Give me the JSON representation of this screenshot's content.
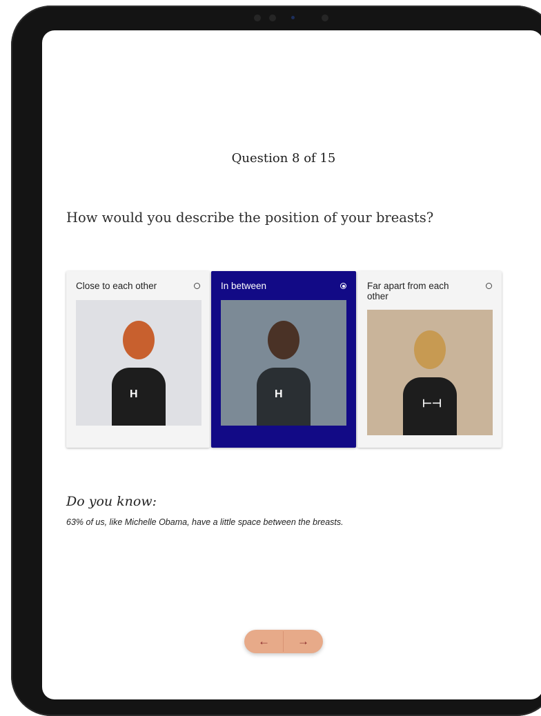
{
  "quiz": {
    "progress": "Question 8 of 15",
    "question": "How would you describe the position of your breasts?",
    "options": [
      {
        "label": "Close to each other",
        "selected": false,
        "marker": "H"
      },
      {
        "label": "In between",
        "selected": true,
        "marker": "H"
      },
      {
        "label": "Far apart from each other",
        "selected": false,
        "marker": "⊢⊣"
      }
    ]
  },
  "info": {
    "title": "Do you know:",
    "text": "63% of us, like Michelle Obama, have a little space between the breasts."
  },
  "nav": {
    "prev_icon": "←",
    "next_icon": "→"
  },
  "colors": {
    "selected_card": "#120a86",
    "nav_button": "#e7aa89",
    "nav_icon": "#8a2c2c"
  }
}
